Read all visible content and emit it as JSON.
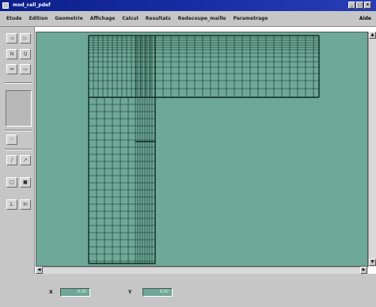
{
  "window": {
    "title": "mod_cell_pdef",
    "btn_min": "_",
    "btn_max": "□",
    "btn_close": "x"
  },
  "menu": {
    "items": [
      "Etude",
      "Edition",
      "Geometrie",
      "Affichage",
      "Calcul",
      "Resultats",
      "Redecoupe_maille",
      "Parametrage"
    ],
    "help": "Aide"
  },
  "toolbar": {
    "btn_undo": "◁",
    "btn_redo": "▷",
    "btn_zoom_in": "N",
    "btn_zoom_out": "Q",
    "btn_pan": "⇔",
    "btn_fit": "▭",
    "btn_node": "⁘",
    "btn_line": "/",
    "btn_arrow": "↗",
    "btn_rect": "□",
    "btn_fill": "■",
    "btn_label": "1.",
    "btn_text": "In"
  },
  "status": {
    "x_label": "X",
    "x_value": "0,00",
    "y_label": "Y",
    "y_value": "0,00"
  },
  "colors": {
    "canvas": "#6ea896",
    "mesh_line": "#0d2a1e",
    "title_bar": "#0b1f8a"
  }
}
